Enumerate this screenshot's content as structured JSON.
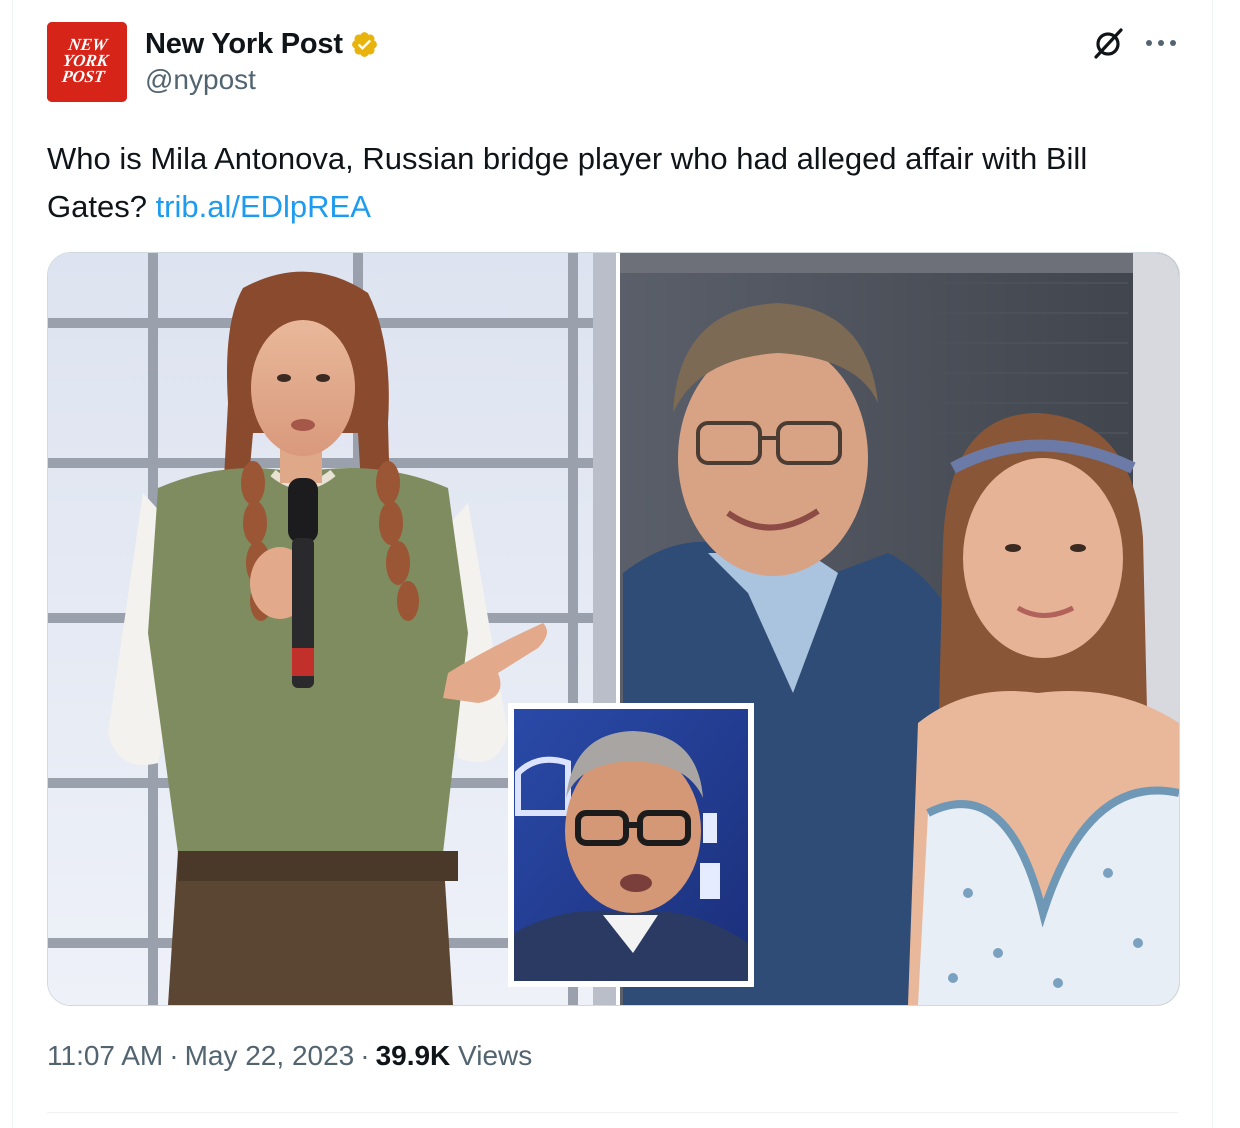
{
  "author": {
    "display_name": "New York Post",
    "handle": "@nypost",
    "avatar_logo_lines": [
      "NEW",
      "YORK",
      "POST"
    ],
    "verified": true,
    "verified_color": "#e8b30a",
    "avatar_color": "#d62418"
  },
  "header_actions": {
    "grok_icon": "grok-icon",
    "more_icon": "more-horizontal-icon"
  },
  "tweet": {
    "text": "Who is Mila Antonova, Russian bridge player who had alleged affair with Bill Gates? ",
    "link_text": "trib.al/EDlpREA",
    "link_color": "#1d9bf0"
  },
  "media": {
    "panels": [
      "woman-speaking-with-microphone-photo",
      "bill-gates-and-woman-selfie-photo",
      "bill-gates-inset-portrait-photo"
    ]
  },
  "meta": {
    "time": "11:07 AM",
    "separator": "·",
    "date": "May 22, 2023",
    "views_count": "39.9K",
    "views_label": " Views"
  }
}
